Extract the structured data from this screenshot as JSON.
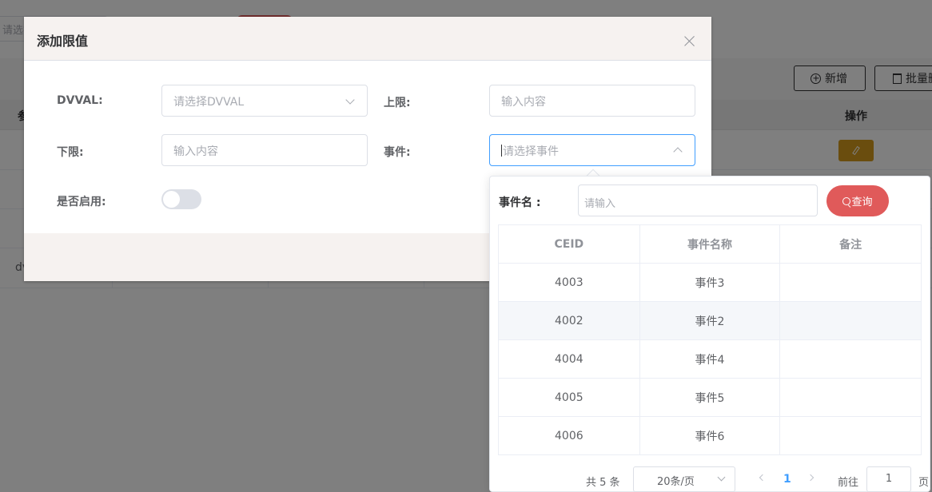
{
  "background": {
    "filter_placeholder": "请选择",
    "toolbar": {
      "add_label": "新增",
      "batch_label": "批量删"
    },
    "table": {
      "col_first": "参",
      "col_action": "操作",
      "row_cell_fragment": "dv"
    }
  },
  "dialog": {
    "title": "添加限值",
    "form": {
      "dvval_label": "DVVAL:",
      "dvval_placeholder": "请选择DVVAL",
      "upper_label": "上限:",
      "upper_placeholder": "输入内容",
      "lower_label": "下限:",
      "lower_placeholder": "输入内容",
      "event_label": "事件:",
      "event_placeholder": "请选择事件",
      "enabled_label": "是否启用:",
      "enabled": false
    }
  },
  "popover": {
    "search_label": "事件名 :",
    "search_placeholder": "请输入",
    "search_button": "查询",
    "columns": [
      "CEID",
      "事件名称",
      "备注"
    ],
    "rows": [
      {
        "ceid": "4003",
        "name": "事件3",
        "remark": ""
      },
      {
        "ceid": "4002",
        "name": "事件2",
        "remark": ""
      },
      {
        "ceid": "4004",
        "name": "事件4",
        "remark": ""
      },
      {
        "ceid": "4005",
        "name": "事件5",
        "remark": ""
      },
      {
        "ceid": "4006",
        "name": "事件6",
        "remark": ""
      }
    ],
    "pagination": {
      "total_text": "共 5 条",
      "page_size": "20条/页",
      "current_page": "1",
      "goto_label": "前往",
      "goto_value": "1",
      "page_suffix": "页"
    }
  }
}
